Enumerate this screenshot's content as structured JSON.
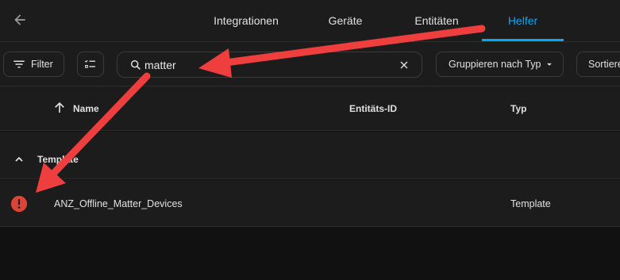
{
  "tabs": [
    {
      "label": "Integrationen"
    },
    {
      "label": "Geräte"
    },
    {
      "label": "Entitäten"
    },
    {
      "label": "Helfer"
    }
  ],
  "toolbar": {
    "filter_label": "Filter",
    "search_value": "matter",
    "group_label": "Gruppieren nach Typ",
    "sort_label": "Sortieren"
  },
  "table": {
    "columns": {
      "name": "Name",
      "entity_id": "Entitäts-ID",
      "type": "Typ"
    },
    "group": {
      "label": "Template"
    },
    "rows": [
      {
        "name": "ANZ_Offline_Matter_Devices",
        "entity_id": "",
        "type": "Template",
        "status": "error"
      }
    ]
  },
  "colors": {
    "accent": "#03a9f4",
    "error": "#db4437",
    "annotation_arrow": "#ef3e3e"
  }
}
